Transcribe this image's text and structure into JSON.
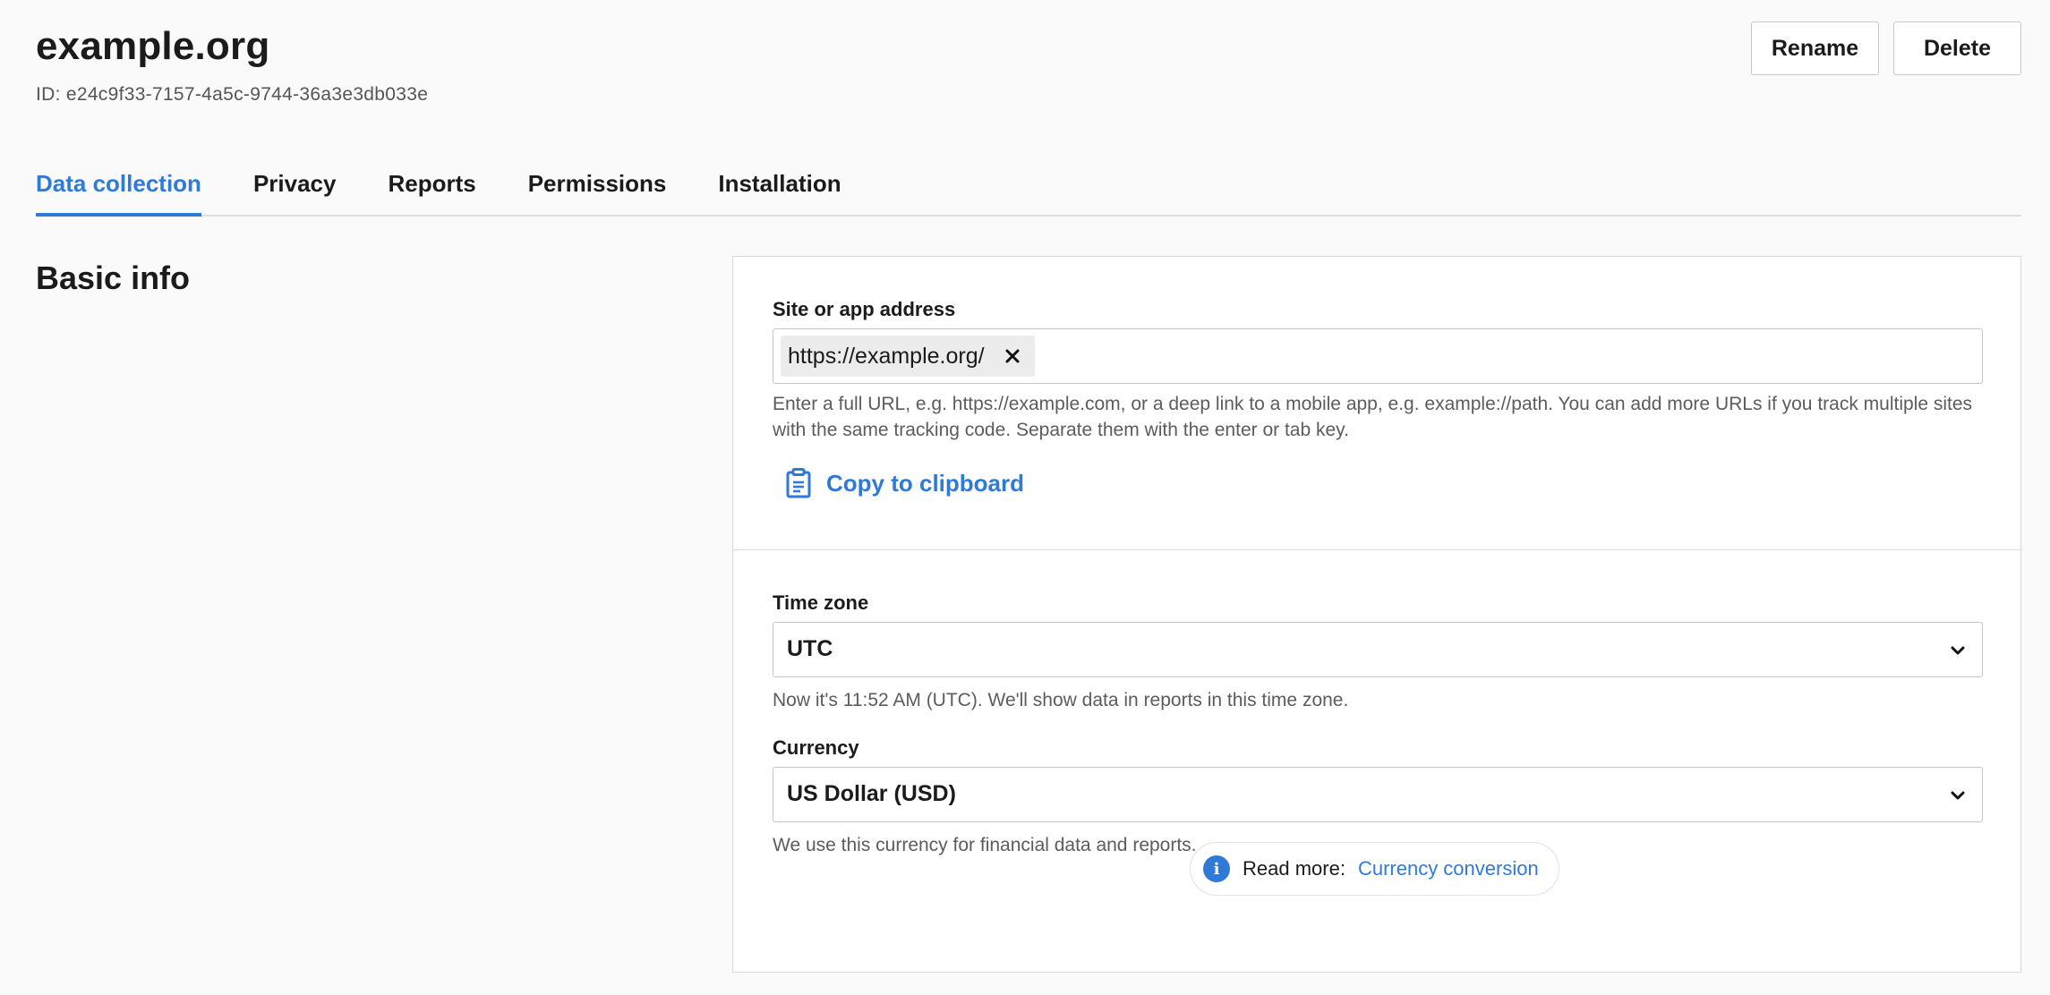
{
  "header": {
    "title": "example.org",
    "id_text": "ID: e24c9f33-7157-4a5c-9744-36a3e3db033e",
    "rename_label": "Rename",
    "delete_label": "Delete"
  },
  "tabs": [
    {
      "label": "Data collection",
      "active": true
    },
    {
      "label": "Privacy",
      "active": false
    },
    {
      "label": "Reports",
      "active": false
    },
    {
      "label": "Permissions",
      "active": false
    },
    {
      "label": "Installation",
      "active": false
    }
  ],
  "section": {
    "heading": "Basic info"
  },
  "site_address": {
    "label": "Site or app address",
    "chip_value": "https://example.org/",
    "remove_icon": "close-icon",
    "help_text": "Enter a full URL, e.g. https://example.com, or a deep link to a mobile app, e.g. example://path. You can add more URLs if you track multiple sites with the same tracking code. Separate them with the enter or tab key.",
    "copy_label": "Copy to clipboard",
    "copy_icon": "clipboard-icon"
  },
  "time_zone": {
    "label": "Time zone",
    "value": "UTC",
    "help_text": "Now it's 11:52 AM (UTC). We'll show data in reports in this time zone."
  },
  "currency": {
    "label": "Currency",
    "value": "US Dollar (USD)",
    "help_text": "We use this currency for financial data and reports."
  },
  "read_more": {
    "prefix": "Read more:",
    "link_label": "Currency conversion",
    "icon": "info-icon"
  },
  "colors": {
    "accent": "#2f7ad8",
    "background": "#fafafa",
    "border": "#d9d9d9"
  }
}
